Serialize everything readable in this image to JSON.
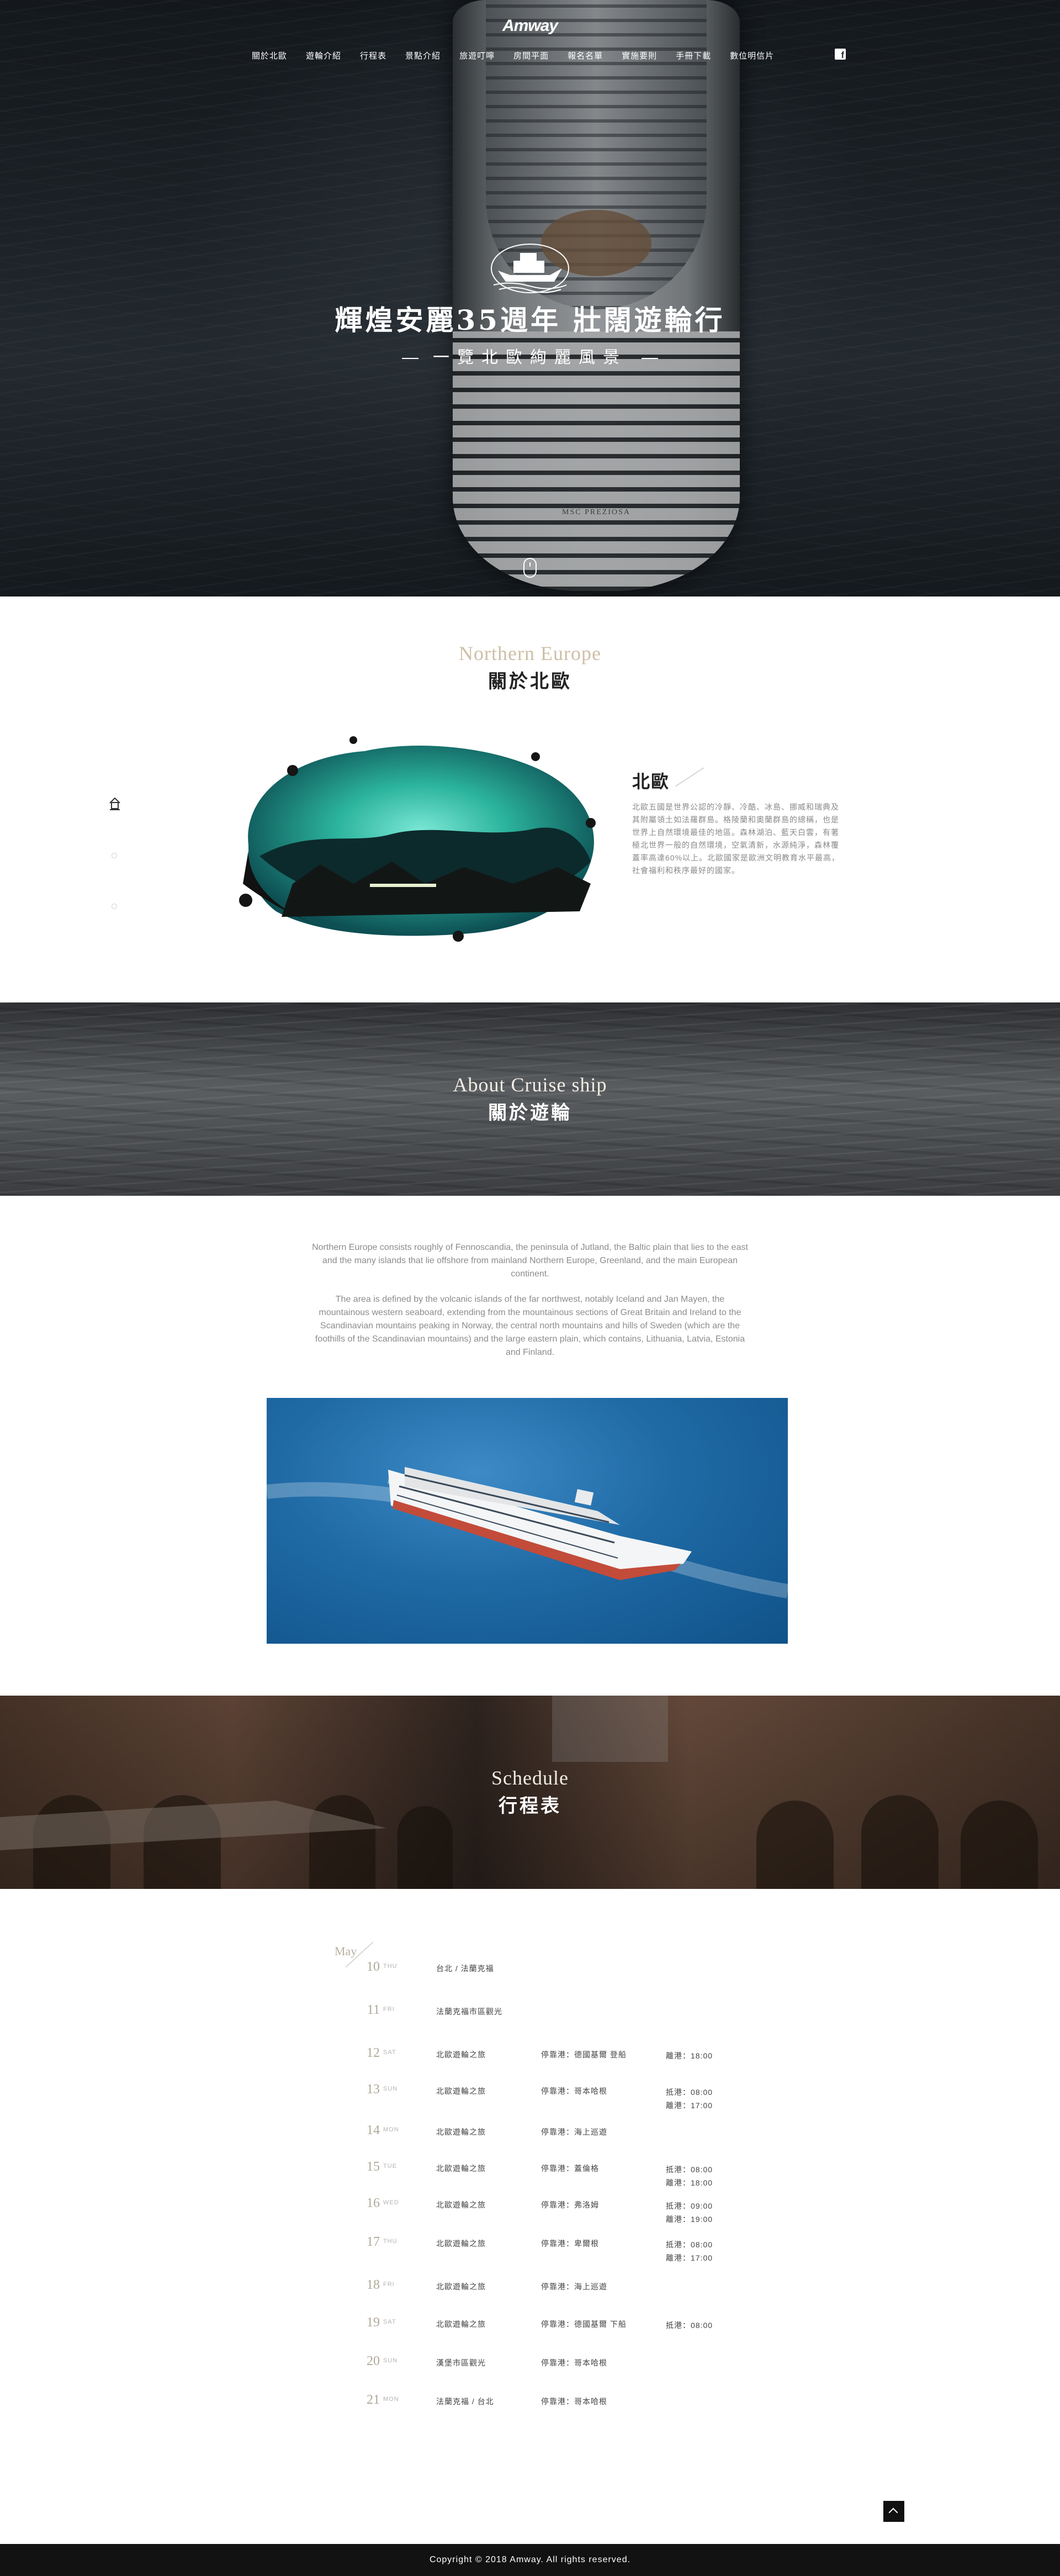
{
  "nav": {
    "logo": "Amway",
    "items": [
      "關於北歐",
      "遊輪介紹",
      "行程表",
      "景點介紹",
      "旅遊叮嚀",
      "房間平面",
      "報名名單",
      "實施要則",
      "手冊下載",
      "數位明信片"
    ],
    "facebook_icon": "facebook-icon"
  },
  "hero": {
    "title": "輝煌安麗35週年 壯闊遊輪行",
    "subtitle": "一覽北歐絢麗風景",
    "ship_name": "MSC PREZIOSA"
  },
  "northern_europe": {
    "en_title": "Northern Europe",
    "zh_title": "關於北歐",
    "heading": "北歐",
    "body": "北歐五國是世界公認的冷靜、冷酷、冰島、挪威和瑞典及其附屬領土如法羅群島。格陵蘭和奧蘭群島的總稱，也是世界上自然環境最佳的地區。森林湖泊、藍天白雲，有著極北世界一般的自然環境，空氣清新，水源純淨，森林覆蓋率高達60%以上。北歐國家是歐洲文明教育水平最高，社會福利和秩序最好的國家。"
  },
  "cruise": {
    "en_title": "About Cruise ship",
    "zh_title": "關於遊輪",
    "paragraphs": [
      "Northern Europe consists roughly of Fennoscandia, the peninsula of Jutland, the Baltic plain that lies to the east and the many islands that lie offshore from mainland Northern Europe, Greenland, and the main European continent.",
      "The area is defined by the volcanic islands of the far northwest, notably Iceland and Jan Mayen, the mountainous western seaboard, extending from the mountainous sections of Great Britain and Ireland to the Scandinavian mountains peaking in Norway, the central north mountains and hills of Sweden (which are the foothills of the Scandinavian mountains) and the large eastern plain, which contains, Lithuania, Latvia, Estonia and Finland."
    ]
  },
  "schedule": {
    "en_title": "Schedule",
    "zh_title": "行程表",
    "month": "May",
    "rows": [
      {
        "day": "10",
        "dow": "THU",
        "route": "台北 / 法蘭克福",
        "port": "",
        "times": []
      },
      {
        "day": "11",
        "dow": "FRI",
        "route": "法蘭克福市區觀光",
        "port": "",
        "times": []
      },
      {
        "day": "12",
        "dow": "SAT",
        "route": "北歐遊輪之旅",
        "port": "停靠港：德國基爾 登船",
        "times": [
          "離港：18:00"
        ]
      },
      {
        "day": "13",
        "dow": "SUN",
        "route": "北歐遊輪之旅",
        "port": "停靠港：哥本哈根",
        "times": [
          "抵港：08:00",
          "離港：17:00"
        ]
      },
      {
        "day": "14",
        "dow": "MON",
        "route": "北歐遊輪之旅",
        "port": "停靠港：海上巡遊",
        "times": []
      },
      {
        "day": "15",
        "dow": "TUE",
        "route": "北歐遊輪之旅",
        "port": "停靠港：蓋倫格",
        "times": [
          "抵港：08:00",
          "離港：18:00"
        ]
      },
      {
        "day": "16",
        "dow": "WED",
        "route": "北歐遊輪之旅",
        "port": "停靠港：弗洛姆",
        "times": [
          "抵港：09:00",
          "離港：19:00"
        ]
      },
      {
        "day": "17",
        "dow": "THU",
        "route": "北歐遊輪之旅",
        "port": "停靠港：卑爾根",
        "times": [
          "抵港：08:00",
          "離港：17:00"
        ]
      },
      {
        "day": "18",
        "dow": "FRI",
        "route": "北歐遊輪之旅",
        "port": "停靠港：海上巡遊",
        "times": []
      },
      {
        "day": "19",
        "dow": "SAT",
        "route": "北歐遊輪之旅",
        "port": "停靠港：德國基爾 下船",
        "times": [
          "抵港：08:00"
        ]
      },
      {
        "day": "20",
        "dow": "SUN",
        "route": "漢堡市區觀光",
        "port": "停靠港：哥本哈根",
        "times": []
      },
      {
        "day": "21",
        "dow": "MON",
        "route": "法蘭克福 / 台北",
        "port": "停靠港：哥本哈根",
        "times": []
      }
    ]
  },
  "side_nav": {
    "home_icon": "home-icon",
    "dots": 2
  },
  "back_to_top_icon": "chevron-up-icon",
  "footer": {
    "copyright": "Copyright © 2018 Amway. All rights reserved."
  }
}
